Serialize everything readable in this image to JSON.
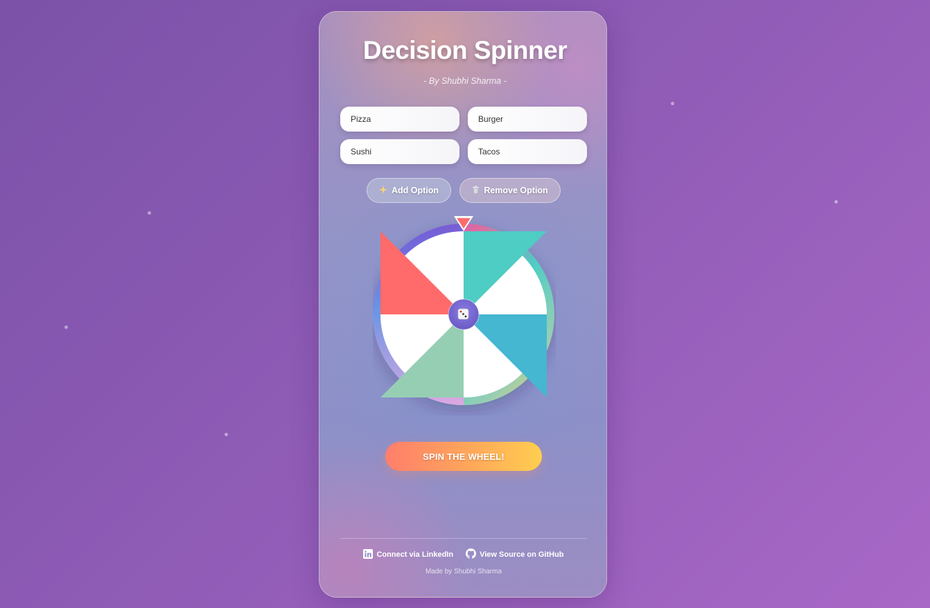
{
  "app": {
    "title": "Decision Spinner",
    "subtitle": "- By Shubhi Sharma -"
  },
  "options": [
    {
      "value": "Pizza"
    },
    {
      "value": "Burger"
    },
    {
      "value": "Sushi"
    },
    {
      "value": "Tacos"
    }
  ],
  "controls": {
    "add_label": "Add Option",
    "add_icon": "sparkles-icon",
    "remove_label": "Remove Option",
    "remove_icon": "trash-icon"
  },
  "wheel": {
    "center_icon": "dice-icon",
    "pointer_color": "#ff6b6b",
    "segment_colors": [
      "#4ecdc4",
      "#45b7d1",
      "#96ceb4",
      "#ff6b6b"
    ]
  },
  "spin": {
    "label": "SPIN THE WHEEL!"
  },
  "footer": {
    "linkedin_label": "Connect via LinkedIn",
    "github_label": "View Source on GitHub",
    "made_by": "Made by Shubhi Sharma"
  }
}
